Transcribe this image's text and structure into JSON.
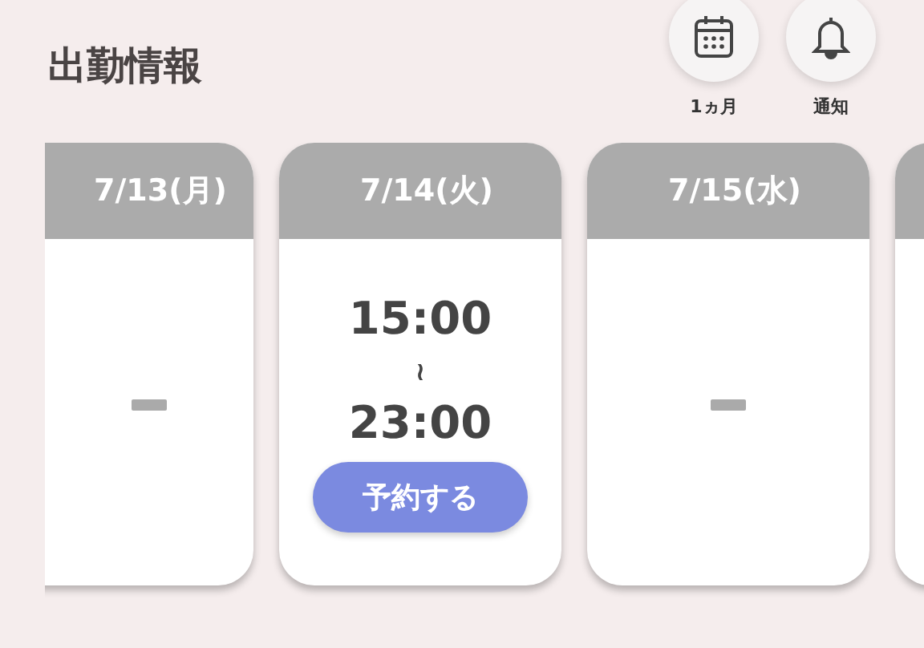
{
  "title": "出勤情報",
  "actions": [
    {
      "kind": "calendar",
      "label": "1ヵ月"
    },
    {
      "kind": "bell",
      "label": "通知"
    }
  ],
  "days": [
    {
      "kind": "off",
      "date": "7/13(月)"
    },
    {
      "kind": "shift",
      "date": "7/14(火)",
      "start": "15:00",
      "separator": "≀",
      "end": "23:00",
      "button": "予約する"
    },
    {
      "kind": "off",
      "date": "7/15(水)"
    },
    {
      "kind": "blank"
    }
  ]
}
